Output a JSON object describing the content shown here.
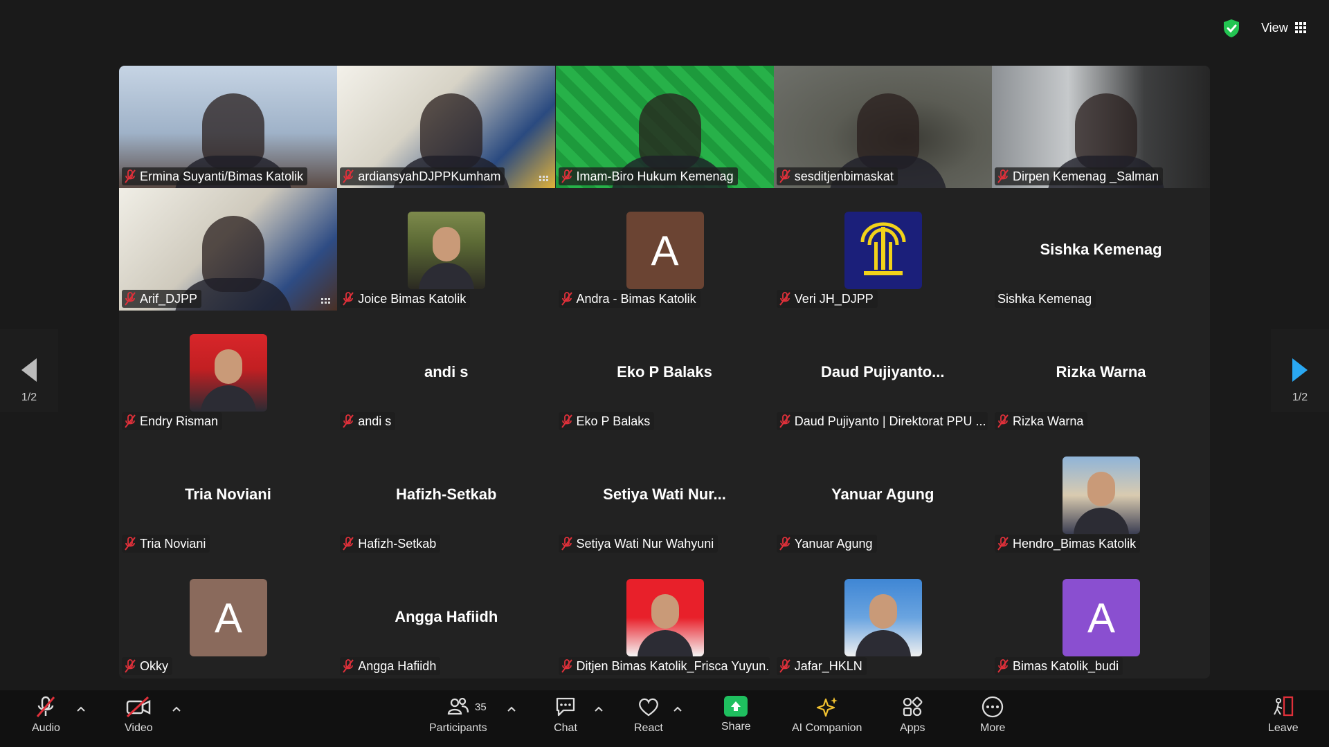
{
  "topbar": {
    "view_label": "View"
  },
  "colors": {
    "active_border": "#2fd26f",
    "muted_red": "#e0303a",
    "share_green": "#1fbf5f",
    "arrow_blue": "#2aa8f2"
  },
  "participants": [
    {
      "name": "Ermina Suyanti/Bimas Katolik",
      "type": "video"
    },
    {
      "name": "ardiansyahDJPPKumham",
      "type": "video"
    },
    {
      "name": "Imam-Biro Hukum Kemenag",
      "type": "video",
      "active": true
    },
    {
      "name": "sesditjenbimaskat",
      "type": "video"
    },
    {
      "name": "Dirpen Kemenag _Salman",
      "type": "video"
    },
    {
      "name": "Arif_DJPP",
      "type": "video"
    },
    {
      "name": "Joice Bimas Katolik",
      "type": "photo"
    },
    {
      "name": "Andra - Bimas Katolik",
      "type": "letter",
      "letter": "A",
      "color": "#6b4433"
    },
    {
      "name": "Veri JH_DJPP",
      "type": "logo"
    },
    {
      "name": "Sishka Kemenag",
      "type": "text",
      "display": "Sishka Kemenag"
    },
    {
      "name": "Endry Risman",
      "type": "photo"
    },
    {
      "name": "andi s",
      "type": "text",
      "display": "andi s"
    },
    {
      "name": "Eko P Balaks",
      "type": "text",
      "display": "Eko P Balaks"
    },
    {
      "name": "Daud Pujiyanto | Direktorat PPU ...",
      "type": "text",
      "display": "Daud  Pujiyanto..."
    },
    {
      "name": "Rizka Warna",
      "type": "text",
      "display": "Rizka Warna"
    },
    {
      "name": "Tria Noviani",
      "type": "text",
      "display": "Tria Noviani"
    },
    {
      "name": "Hafizh-Setkab",
      "type": "text",
      "display": "Hafizh-Setkab"
    },
    {
      "name": "Setiya Wati Nur Wahyuni",
      "type": "text",
      "display": "Setiya  Wati  Nur..."
    },
    {
      "name": "Yanuar Agung",
      "type": "text",
      "display": "Yanuar Agung"
    },
    {
      "name": "Hendro_Bimas Katolik",
      "type": "photo"
    },
    {
      "name": "Okky",
      "type": "letter",
      "letter": "A",
      "color": "#8a6a5c"
    },
    {
      "name": "Angga Hafiidh",
      "type": "text",
      "display": "Angga Hafiidh"
    },
    {
      "name": "Ditjen Bimas Katolik_Frisca Yuyun...",
      "type": "photo"
    },
    {
      "name": "Jafar_HKLN",
      "type": "photo"
    },
    {
      "name": "Bimas Katolik_budi",
      "type": "letter",
      "letter": "A",
      "color": "#8a4fd0"
    }
  ],
  "pager": {
    "left_count": "1/2",
    "right_count": "1/2"
  },
  "toolbar": {
    "audio": "Audio",
    "video": "Video",
    "participants": "Participants",
    "participants_count": "35",
    "chat": "Chat",
    "react": "React",
    "share": "Share",
    "ai_companion": "AI Companion",
    "apps": "Apps",
    "more": "More",
    "leave": "Leave"
  }
}
